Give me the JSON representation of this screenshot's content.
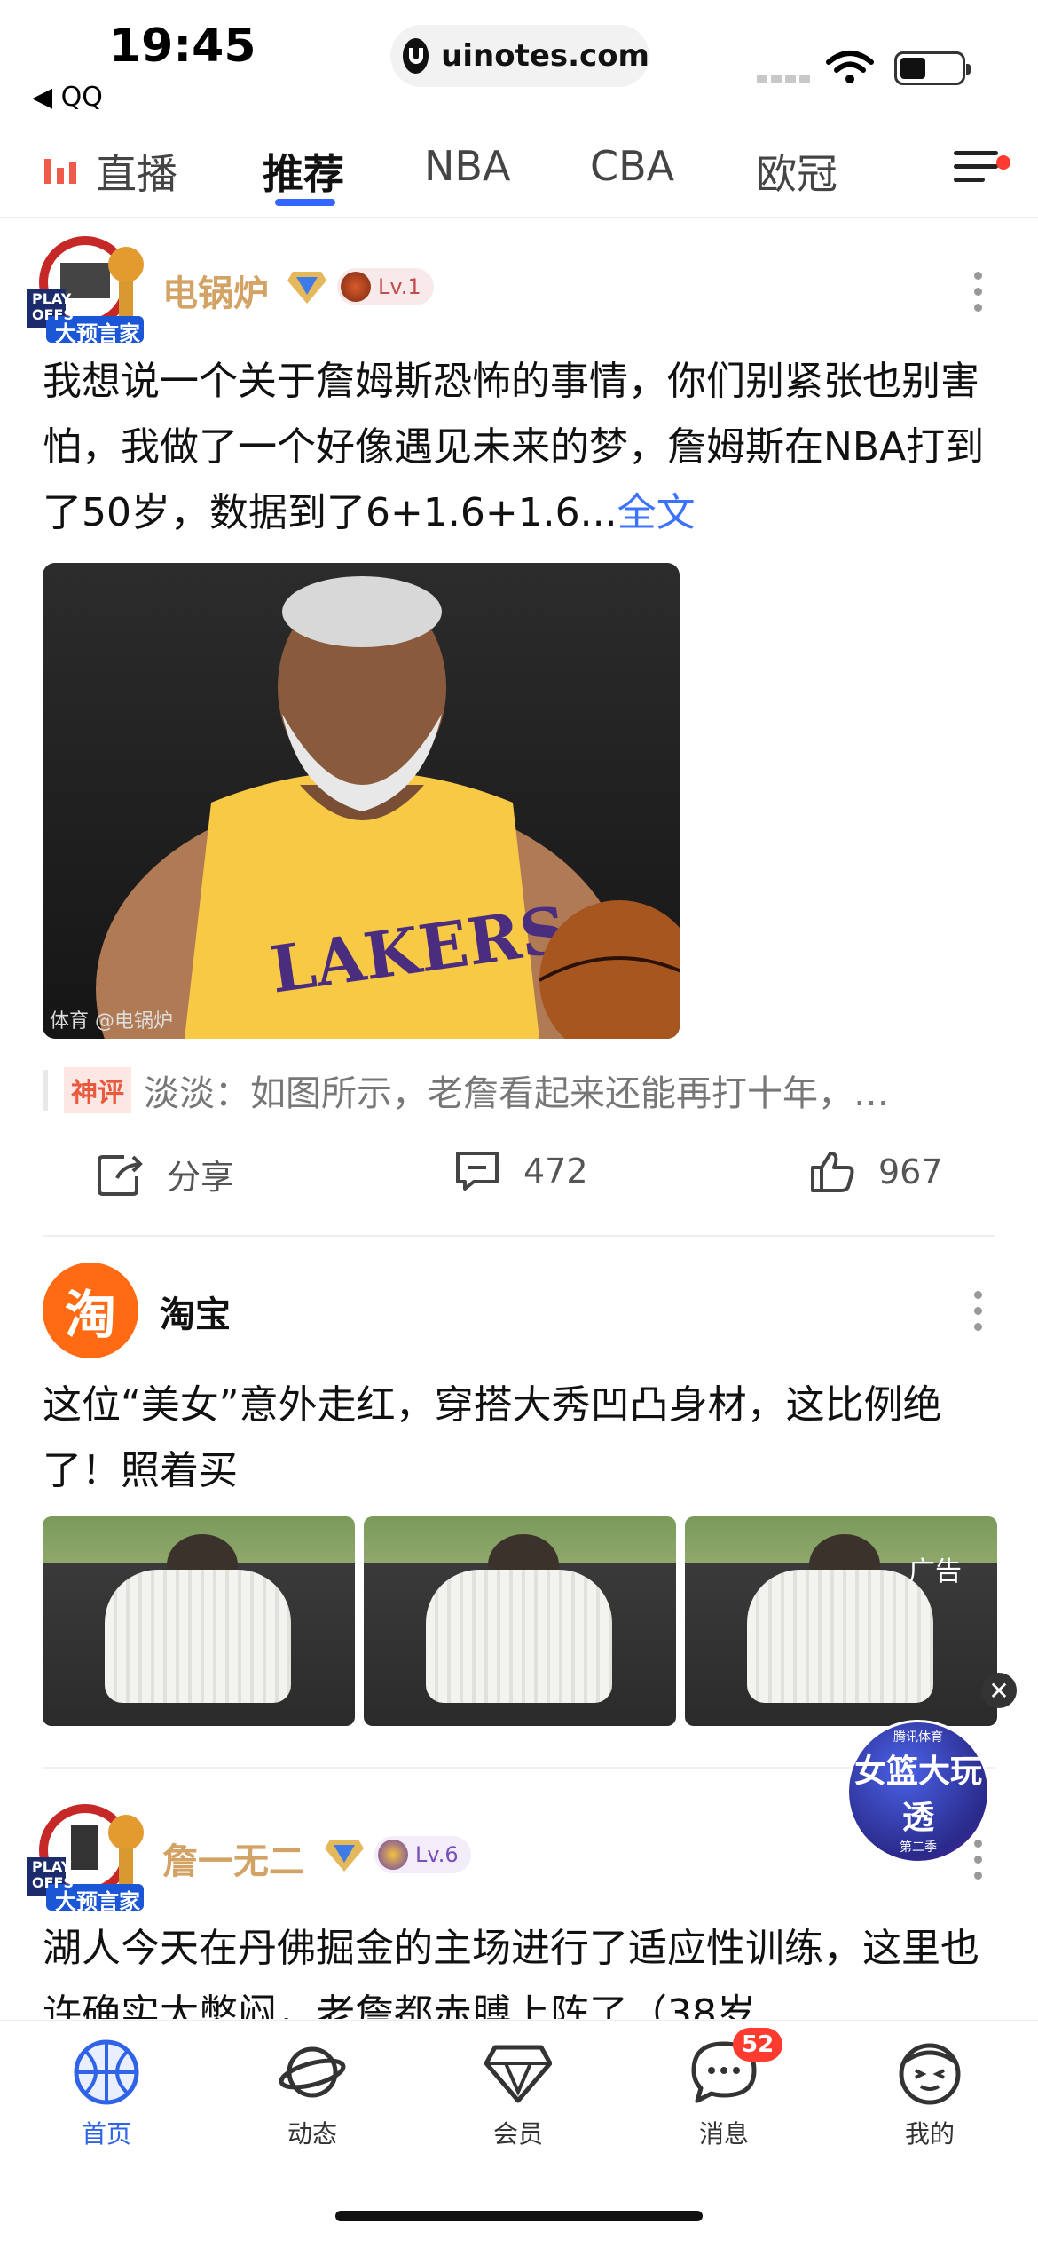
{
  "status_bar": {
    "time": "19:45",
    "back_app": "◀ QQ",
    "url": "uinotes.com"
  },
  "tabs": [
    {
      "label": "直播"
    },
    {
      "label": "推荐",
      "active": true
    },
    {
      "label": "NBA"
    },
    {
      "label": "CBA"
    },
    {
      "label": "欧冠"
    }
  ],
  "post1": {
    "badge_top": "PLAY OFFS",
    "badge_bottom": "大预言家",
    "username": "电锅炉",
    "level": "Lv.1",
    "text": "我想说一个关于詹姆斯恐怖的事情，你们别紧张也别害怕，我做了一个好像遇见未来的梦，詹姆斯在NBA打到了50岁，数据到了6+1.6+1.6...",
    "more_link": "全文",
    "image_watermark": "体育 @电锅炉",
    "comment_tag": "神评",
    "comment_text": "淡淡：如图所示，老詹看起来还能再打十年，哈…",
    "share_label": "分享",
    "comments_count": "472",
    "likes_count": "967"
  },
  "ad": {
    "logo_char": "淘",
    "name": "淘宝",
    "text": "这位“美女”意外走红，穿搭大秀凹凸身材，这比例绝了！照着买",
    "label": "广告",
    "close": "✕",
    "float_badge_top": "腾讯体育",
    "float_badge_main": "女篮大玩透",
    "float_badge_sub": "第二季"
  },
  "post2": {
    "badge_top": "PLAY OFFS",
    "badge_bottom": "大预言家",
    "username": "詹一无二",
    "level": "Lv.6",
    "text": "湖人今天在丹佛掘金的主场进行了适应性训练，这里也许确实太憋闷，老詹都赤膊上阵了（38岁"
  },
  "bottom_nav": [
    {
      "label": "首页",
      "icon": "basketball-icon",
      "active": true
    },
    {
      "label": "动态",
      "icon": "planet-icon"
    },
    {
      "label": "会员",
      "icon": "diamond-icon"
    },
    {
      "label": "消息",
      "icon": "chat-icon",
      "badge": "52"
    },
    {
      "label": "我的",
      "icon": "face-icon"
    }
  ],
  "colors": {
    "accent": "#2f64e8",
    "username": "#d3a265",
    "link": "#3b73ff",
    "taobao": "#ff6a13"
  }
}
